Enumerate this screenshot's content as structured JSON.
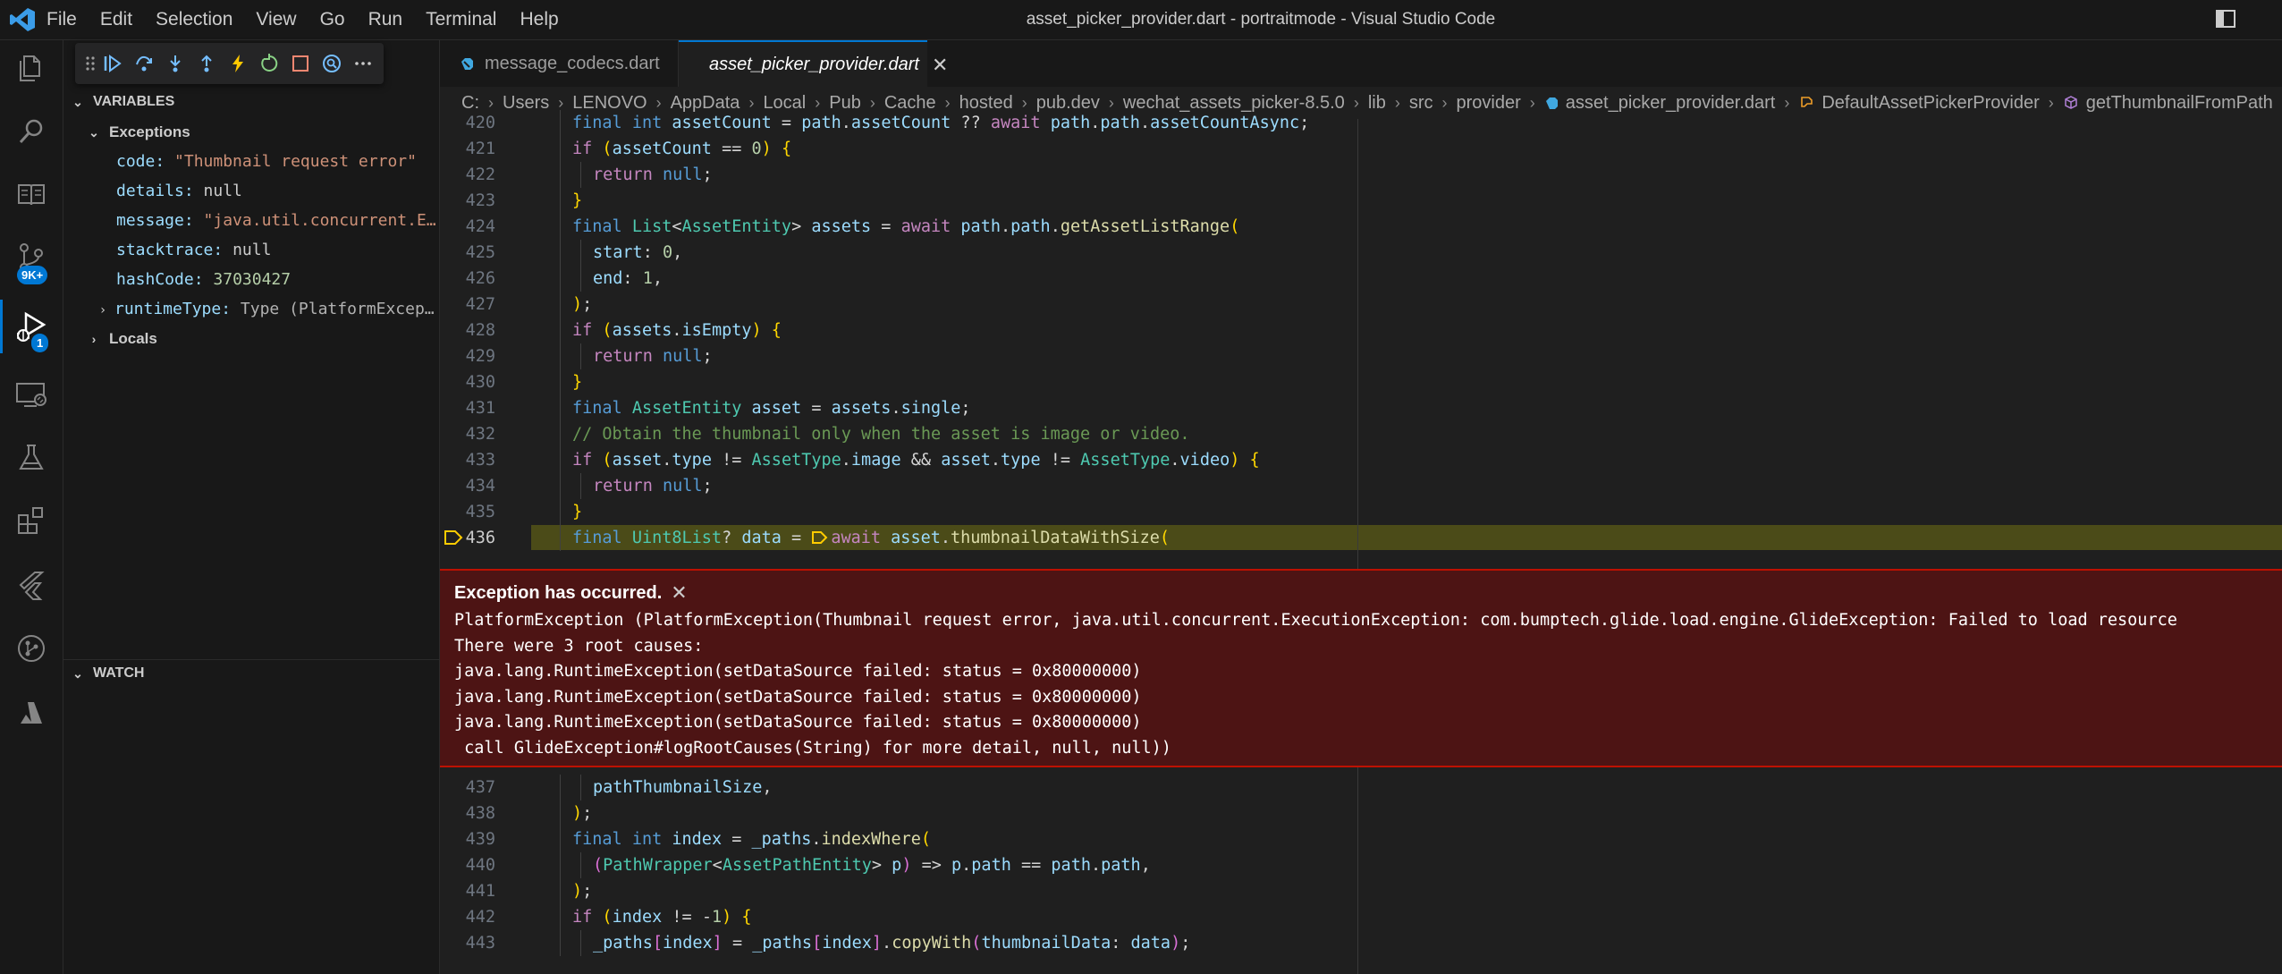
{
  "window": {
    "title": "asset_picker_provider.dart - portraitmode - Visual Studio Code"
  },
  "menu": [
    "File",
    "Edit",
    "Selection",
    "View",
    "Go",
    "Run",
    "Terminal",
    "Help"
  ],
  "activity": {
    "scm_badge": "9K+",
    "debug_badge": "1"
  },
  "sidebar": {
    "variables_title": "VARIABLES",
    "exceptions_label": "Exceptions",
    "variables": [
      {
        "name": "code:",
        "value": "\"Thumbnail request error\"",
        "kind": "str"
      },
      {
        "name": "details:",
        "value": "null",
        "kind": "plain"
      },
      {
        "name": "message:",
        "value": "\"java.util.concurrent.E…",
        "kind": "str"
      },
      {
        "name": "stacktrace:",
        "value": "null",
        "kind": "plain"
      },
      {
        "name": "hashCode:",
        "value": "37030427",
        "kind": "num"
      }
    ],
    "runtime_type_name": "runtimeType:",
    "runtime_type_value": "Type (PlatformExcep…",
    "locals_label": "Locals",
    "watch_title": "WATCH"
  },
  "tabs": [
    {
      "label": "message_codecs.dart",
      "active": false
    },
    {
      "label": "asset_picker_provider.dart",
      "active": true
    }
  ],
  "breadcrumb": [
    "C:",
    "Users",
    "LENOVO",
    "AppData",
    "Local",
    "Pub",
    "Cache",
    "hosted",
    "pub.dev",
    "wechat_assets_picker-8.5.0",
    "lib",
    "src",
    "provider",
    "asset_picker_provider.dart",
    "DefaultAssetPickerProvider",
    "getThumbnailFromPath"
  ],
  "code_top": [
    {
      "n": "420",
      "indent": 1,
      "tokens": [
        [
          "kw",
          "final "
        ],
        [
          "kw",
          "int "
        ],
        [
          "vr",
          "assetCount"
        ],
        [
          "pl",
          " = "
        ],
        [
          "vr",
          "path"
        ],
        [
          "pl",
          "."
        ],
        [
          "vr",
          "assetCount"
        ],
        [
          "pl",
          " ?? "
        ],
        [
          "ctl",
          "await "
        ],
        [
          "vr",
          "path"
        ],
        [
          "pl",
          "."
        ],
        [
          "vr",
          "path"
        ],
        [
          "pl",
          "."
        ],
        [
          "vr",
          "assetCountAsync"
        ],
        [
          "pl",
          ";"
        ]
      ]
    },
    {
      "n": "421",
      "indent": 1,
      "tokens": [
        [
          "ctl",
          "if "
        ],
        [
          "br1",
          "("
        ],
        [
          "vr",
          "assetCount"
        ],
        [
          "pl",
          " == "
        ],
        [
          "nm",
          "0"
        ],
        [
          "br1",
          ")"
        ],
        [
          "pl",
          " "
        ],
        [
          "br1",
          "{"
        ]
      ]
    },
    {
      "n": "422",
      "indent": 2,
      "tokens": [
        [
          "ctl",
          "return "
        ],
        [
          "kw",
          "null"
        ],
        [
          "pl",
          ";"
        ]
      ]
    },
    {
      "n": "423",
      "indent": 1,
      "tokens": [
        [
          "br1",
          "}"
        ]
      ]
    },
    {
      "n": "424",
      "indent": 1,
      "tokens": [
        [
          "kw",
          "final "
        ],
        [
          "ty",
          "List"
        ],
        [
          "pl",
          "<"
        ],
        [
          "ty",
          "AssetEntity"
        ],
        [
          "pl",
          "> "
        ],
        [
          "vr",
          "assets"
        ],
        [
          "pl",
          " = "
        ],
        [
          "ctl",
          "await "
        ],
        [
          "vr",
          "path"
        ],
        [
          "pl",
          "."
        ],
        [
          "vr",
          "path"
        ],
        [
          "pl",
          "."
        ],
        [
          "fn",
          "getAssetListRange"
        ],
        [
          "br1",
          "("
        ]
      ]
    },
    {
      "n": "425",
      "indent": 2,
      "tokens": [
        [
          "vr",
          "start"
        ],
        [
          "pl",
          ": "
        ],
        [
          "nm",
          "0"
        ],
        [
          "pl",
          ","
        ]
      ]
    },
    {
      "n": "426",
      "indent": 2,
      "tokens": [
        [
          "vr",
          "end"
        ],
        [
          "pl",
          ": "
        ],
        [
          "nm",
          "1"
        ],
        [
          "pl",
          ","
        ]
      ]
    },
    {
      "n": "427",
      "indent": 1,
      "tokens": [
        [
          "br1",
          ")"
        ],
        [
          "pl",
          ";"
        ]
      ]
    },
    {
      "n": "428",
      "indent": 1,
      "tokens": [
        [
          "ctl",
          "if "
        ],
        [
          "br1",
          "("
        ],
        [
          "vr",
          "assets"
        ],
        [
          "pl",
          "."
        ],
        [
          "vr",
          "isEmpty"
        ],
        [
          "br1",
          ")"
        ],
        [
          "pl",
          " "
        ],
        [
          "br1",
          "{"
        ]
      ]
    },
    {
      "n": "429",
      "indent": 2,
      "tokens": [
        [
          "ctl",
          "return "
        ],
        [
          "kw",
          "null"
        ],
        [
          "pl",
          ";"
        ]
      ]
    },
    {
      "n": "430",
      "indent": 1,
      "tokens": [
        [
          "br1",
          "}"
        ]
      ]
    },
    {
      "n": "431",
      "indent": 1,
      "tokens": [
        [
          "kw",
          "final "
        ],
        [
          "ty",
          "AssetEntity "
        ],
        [
          "vr",
          "asset"
        ],
        [
          "pl",
          " = "
        ],
        [
          "vr",
          "assets"
        ],
        [
          "pl",
          "."
        ],
        [
          "vr",
          "single"
        ],
        [
          "pl",
          ";"
        ]
      ]
    },
    {
      "n": "432",
      "indent": 1,
      "tokens": [
        [
          "cm",
          "// Obtain the thumbnail only when the asset is image or video."
        ]
      ]
    },
    {
      "n": "433",
      "indent": 1,
      "tokens": [
        [
          "ctl",
          "if "
        ],
        [
          "br1",
          "("
        ],
        [
          "vr",
          "asset"
        ],
        [
          "pl",
          "."
        ],
        [
          "vr",
          "type"
        ],
        [
          "pl",
          " != "
        ],
        [
          "ty",
          "AssetType"
        ],
        [
          "pl",
          "."
        ],
        [
          "vr",
          "image"
        ],
        [
          "pl",
          " && "
        ],
        [
          "vr",
          "asset"
        ],
        [
          "pl",
          "."
        ],
        [
          "vr",
          "type"
        ],
        [
          "pl",
          " != "
        ],
        [
          "ty",
          "AssetType"
        ],
        [
          "pl",
          "."
        ],
        [
          "vr",
          "video"
        ],
        [
          "br1",
          ")"
        ],
        [
          "pl",
          " "
        ],
        [
          "br1",
          "{"
        ]
      ]
    },
    {
      "n": "434",
      "indent": 2,
      "tokens": [
        [
          "ctl",
          "return "
        ],
        [
          "kw",
          "null"
        ],
        [
          "pl",
          ";"
        ]
      ]
    },
    {
      "n": "435",
      "indent": 1,
      "tokens": [
        [
          "br1",
          "}"
        ]
      ]
    },
    {
      "n": "436",
      "indent": 1,
      "current": true,
      "tokens": [
        [
          "kw",
          "final "
        ],
        [
          "ty",
          "Uint8List"
        ],
        [
          "pl",
          "? "
        ],
        [
          "vr",
          "data"
        ],
        [
          "pl",
          " = "
        ],
        [
          "marker",
          ""
        ],
        [
          "ctl",
          "await "
        ],
        [
          "vr",
          "asset"
        ],
        [
          "pl",
          "."
        ],
        [
          "fn",
          "thumbnailDataWithSize"
        ],
        [
          "br1",
          "("
        ]
      ]
    }
  ],
  "exception": {
    "title": "Exception has occurred.",
    "lines": [
      "PlatformException (PlatformException(Thumbnail request error, java.util.concurrent.ExecutionException: com.bumptech.glide.load.engine.GlideException: Failed to load resource",
      "There were 3 root causes:",
      "java.lang.RuntimeException(setDataSource failed: status = 0x80000000)",
      "java.lang.RuntimeException(setDataSource failed: status = 0x80000000)",
      "java.lang.RuntimeException(setDataSource failed: status = 0x80000000)",
      " call GlideException#logRootCauses(String) for more detail, null, null))"
    ]
  },
  "code_bottom": [
    {
      "n": "437",
      "indent": 2,
      "tokens": [
        [
          "vr",
          "pathThumbnailSize"
        ],
        [
          "pl",
          ","
        ]
      ]
    },
    {
      "n": "438",
      "indent": 1,
      "tokens": [
        [
          "br1",
          ")"
        ],
        [
          "pl",
          ";"
        ]
      ]
    },
    {
      "n": "439",
      "indent": 1,
      "tokens": [
        [
          "kw",
          "final "
        ],
        [
          "kw",
          "int "
        ],
        [
          "vr",
          "index"
        ],
        [
          "pl",
          " = "
        ],
        [
          "vr",
          "_paths"
        ],
        [
          "pl",
          "."
        ],
        [
          "fn",
          "indexWhere"
        ],
        [
          "br1",
          "("
        ]
      ]
    },
    {
      "n": "440",
      "indent": 2,
      "tokens": [
        [
          "br2",
          "("
        ],
        [
          "ty",
          "PathWrapper"
        ],
        [
          "pl",
          "<"
        ],
        [
          "ty",
          "AssetPathEntity"
        ],
        [
          "pl",
          "> "
        ],
        [
          "vr",
          "p"
        ],
        [
          "br2",
          ")"
        ],
        [
          "pl",
          " => "
        ],
        [
          "vr",
          "p"
        ],
        [
          "pl",
          "."
        ],
        [
          "vr",
          "path"
        ],
        [
          "pl",
          " == "
        ],
        [
          "vr",
          "path"
        ],
        [
          "pl",
          "."
        ],
        [
          "vr",
          "path"
        ],
        [
          "pl",
          ","
        ]
      ]
    },
    {
      "n": "441",
      "indent": 1,
      "tokens": [
        [
          "br1",
          ")"
        ],
        [
          "pl",
          ";"
        ]
      ]
    },
    {
      "n": "442",
      "indent": 1,
      "tokens": [
        [
          "ctl",
          "if "
        ],
        [
          "br1",
          "("
        ],
        [
          "vr",
          "index"
        ],
        [
          "pl",
          " != -"
        ],
        [
          "nm",
          "1"
        ],
        [
          "br1",
          ")"
        ],
        [
          "pl",
          " "
        ],
        [
          "br1",
          "{"
        ]
      ]
    },
    {
      "n": "443",
      "indent": 2,
      "tokens": [
        [
          "vr",
          "_paths"
        ],
        [
          "br2",
          "["
        ],
        [
          "vr",
          "index"
        ],
        [
          "br2",
          "]"
        ],
        [
          "pl",
          " = "
        ],
        [
          "vr",
          "_paths"
        ],
        [
          "br2",
          "["
        ],
        [
          "vr",
          "index"
        ],
        [
          "br2",
          "]"
        ],
        [
          "pl",
          "."
        ],
        [
          "fn",
          "copyWith"
        ],
        [
          "br2",
          "("
        ],
        [
          "vr",
          "thumbnailData"
        ],
        [
          "pl",
          ": "
        ],
        [
          "vr",
          "data"
        ],
        [
          "br2",
          ")"
        ],
        [
          "pl",
          ";"
        ]
      ]
    }
  ]
}
